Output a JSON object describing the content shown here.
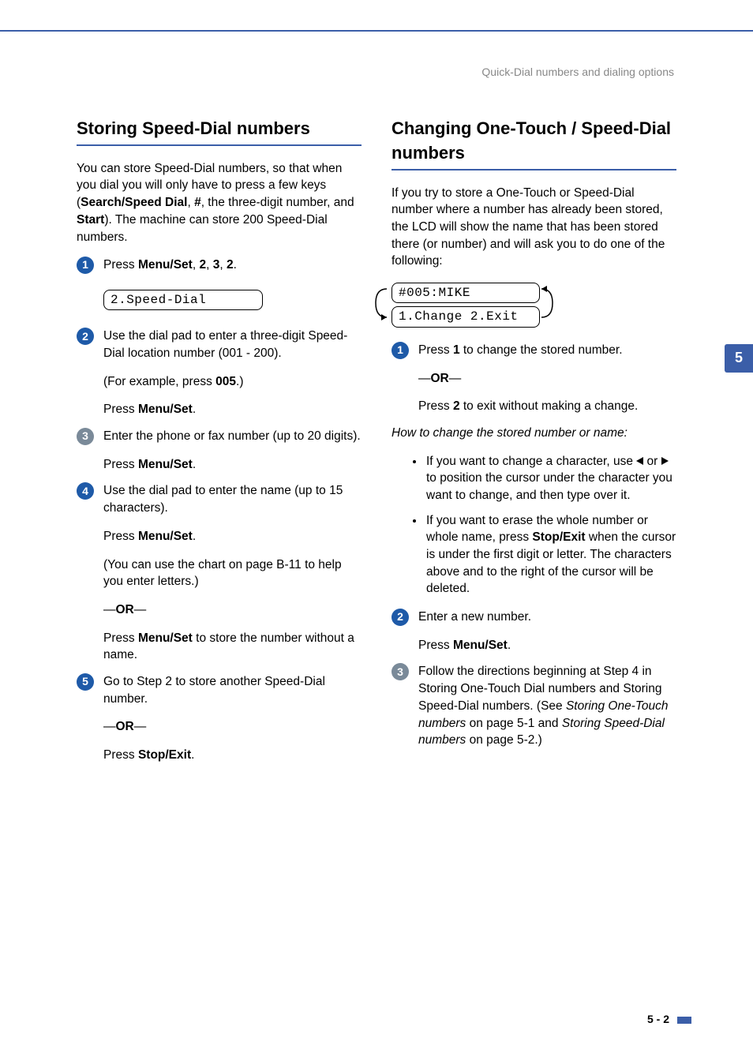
{
  "header": {
    "running": "Quick-Dial numbers and dialing options"
  },
  "left": {
    "title": "Storing Speed-Dial numbers",
    "intro_a": "You can store Speed-Dial numbers, so that when you dial you will only have to press a few keys (",
    "intro_b": "Search/Speed Dial",
    "intro_c": ", ",
    "intro_d": "#",
    "intro_e": ", the three-digit number, and ",
    "intro_f": "Start",
    "intro_g": "). The machine can store 200 Speed-Dial numbers.",
    "s1_a": "Press ",
    "s1_b": "Menu/Set",
    "s1_c": ", ",
    "s1_d": "2",
    "s1_e": ", ",
    "s1_f": "3",
    "s1_g": ", ",
    "s1_h": "2",
    "s1_i": ".",
    "lcd1": "2.Speed-Dial",
    "s2_a": "Use the dial pad to enter a three-digit Speed-Dial location number (001 - 200).",
    "s2_b1": "(For example, press ",
    "s2_b2": "005",
    "s2_b3": ".)",
    "s2_c1": "Press ",
    "s2_c2": "Menu/Set",
    "s2_c3": ".",
    "s3_a": "Enter the phone or fax number (up to 20 digits).",
    "s3_b1": "Press ",
    "s3_b2": "Menu/Set",
    "s3_b3": ".",
    "s4_a": "Use the dial pad to enter the name (up to 15 characters).",
    "s4_b1": "Press ",
    "s4_b2": "Menu/Set",
    "s4_b3": ".",
    "s4_c": "(You can use the chart on page B-11 to help you enter letters.)",
    "or1a": "—",
    "or1b": "OR",
    "or1c": "—",
    "s4_d1": "Press ",
    "s4_d2": "Menu/Set",
    "s4_d3": " to store the number without a name.",
    "s5_a": "Go to Step 2 to store another Speed-Dial number.",
    "or2a": "—",
    "or2b": "OR",
    "or2c": "—",
    "s5_b1": "Press ",
    "s5_b2": "Stop/Exit",
    "s5_b3": "."
  },
  "right": {
    "title": "Changing One-Touch / Speed-Dial numbers",
    "intro": "If you try to store a One-Touch or Speed-Dial number where a number has already been stored, the LCD will show the name that has been stored there (or number) and will ask you to do one of the following:",
    "lcd_top": "#005:MIKE",
    "lcd_bot": "1.Change  2.Exit",
    "s1_a": "Press ",
    "s1_b": "1",
    "s1_c": " to change the stored number.",
    "or1a": "—",
    "or1b": "OR",
    "or1c": "—",
    "s1_d": "Press ",
    "s1_e": "2",
    "s1_f": " to exit without making a change.",
    "howto": "How to change the stored number or name:",
    "tip1_a": "If you want to change a character, use ",
    "tip1_b": " or ",
    "tip1_c": " to position the cursor under the character you want to change, and then type over it.",
    "tip2_a": "If you want to erase the whole number or whole name, press ",
    "tip2_b": "Stop/Exit",
    "tip2_c": " when the cursor is under the first digit or letter. The characters above and to the right of the cursor will be deleted.",
    "s2_a": "Enter a new number.",
    "s2_b1": "Press ",
    "s2_b2": "Menu/Set",
    "s2_b3": ".",
    "s3_a": "Follow the directions beginning at Step 4 in Storing One-Touch Dial numbers and Storing Speed-Dial numbers. (See ",
    "s3_b": "Storing One-Touch numbers",
    "s3_c": " on page 5-1 and ",
    "s3_d": "Storing Speed-Dial numbers",
    "s3_e": " on page 5-2.)"
  },
  "tab": "5",
  "footer": "5 - 2"
}
